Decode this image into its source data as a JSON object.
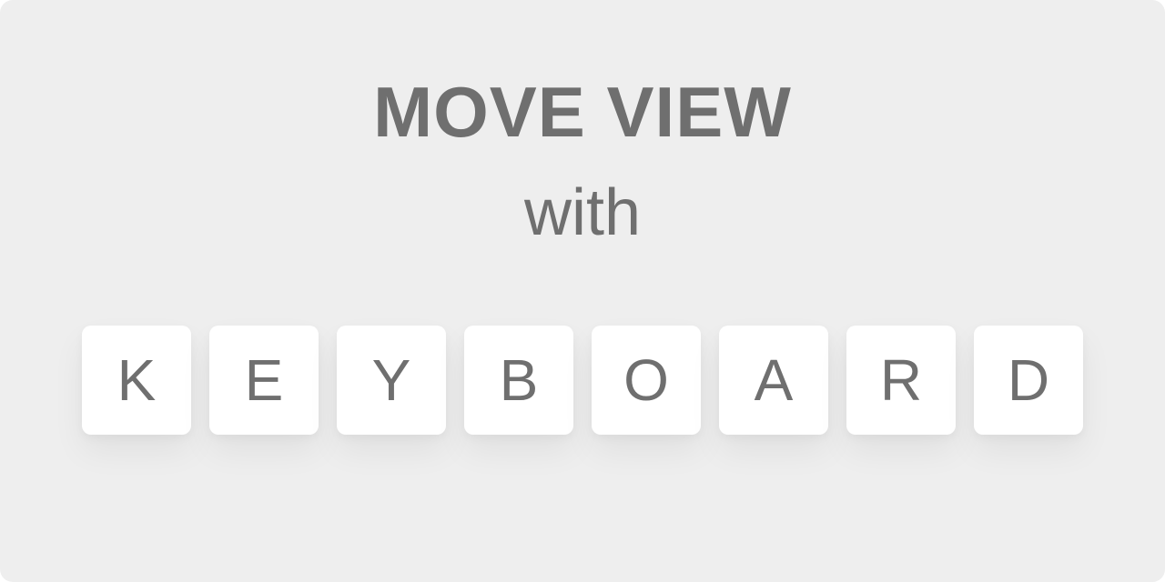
{
  "heading": {
    "title": "MOVE VIEW",
    "subtitle": "with"
  },
  "keys": [
    {
      "label": "K"
    },
    {
      "label": "E"
    },
    {
      "label": "Y"
    },
    {
      "label": "B"
    },
    {
      "label": "O"
    },
    {
      "label": "A"
    },
    {
      "label": "R"
    },
    {
      "label": "D"
    }
  ],
  "colors": {
    "background": "#eeeeee",
    "key_face": "#ffffff",
    "text": "#6f6f6f"
  }
}
